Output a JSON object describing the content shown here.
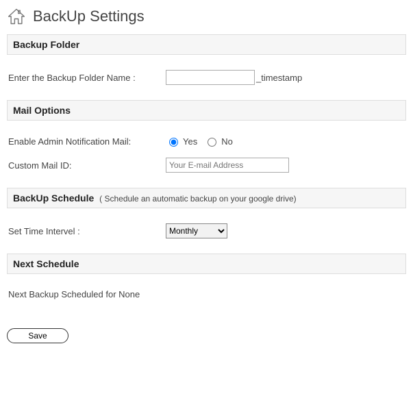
{
  "header": {
    "title": "BackUp Settings",
    "icon": "home-icon"
  },
  "sections": {
    "backup_folder": {
      "heading": "Backup Folder",
      "label": "Enter the Backup Folder Name :",
      "value": "",
      "suffix": "_timestamp"
    },
    "mail_options": {
      "heading": "Mail Options",
      "enable_label": "Enable Admin Notification Mail:",
      "yes_label": "Yes",
      "no_label": "No",
      "selected": "yes",
      "custom_label": "Custom Mail ID:",
      "email_placeholder": "Your E-mail Address",
      "email_value": ""
    },
    "schedule": {
      "heading": "BackUp Schedule",
      "subtitle": "( Schedule an automatic backup on your google drive)",
      "interval_label": "Set Time Intervel :",
      "interval_value": "Monthly"
    },
    "next_schedule": {
      "heading": "Next Schedule",
      "text": "Next Backup Scheduled for None"
    }
  },
  "buttons": {
    "save": "Save"
  }
}
